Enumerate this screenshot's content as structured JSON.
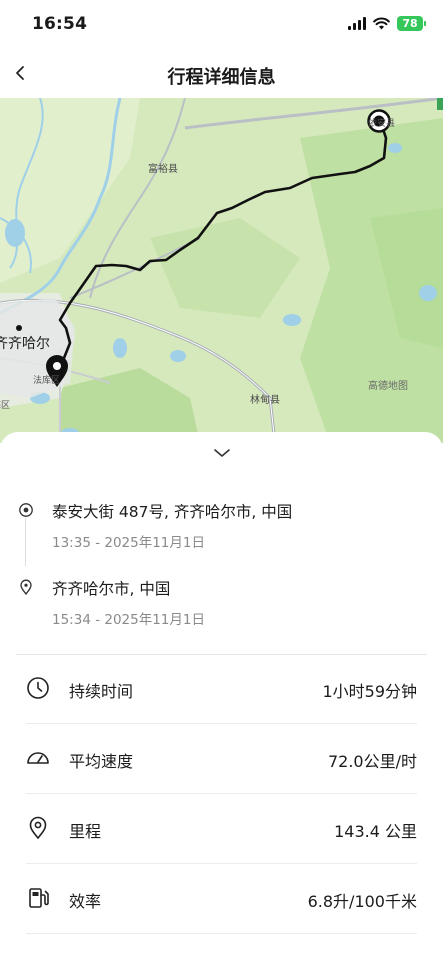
{
  "status_bar": {
    "time": "16:54",
    "battery": "78"
  },
  "nav": {
    "title": "行程详细信息"
  },
  "map": {
    "labels": {
      "fuyu": "富裕县",
      "qiqihar": "齐齐哈尔",
      "linxian": "林甸县",
      "gaode": "高德地图",
      "district_a": "法库区",
      "district_b": "梅区",
      "county_top": "依安县"
    }
  },
  "trip": {
    "start": {
      "address": "泰安大街 487号, 齐齐哈尔市, 中国",
      "time": "13:35 - 2025年11月1日"
    },
    "end": {
      "address": "齐齐哈尔市, 中国",
      "time": "15:34 - 2025年11月1日"
    }
  },
  "stats": [
    {
      "label": "持续时间",
      "value": "1小时59分钟",
      "icon": "clock-icon"
    },
    {
      "label": "平均速度",
      "value": "72.0公里/时",
      "icon": "speedometer-icon"
    },
    {
      "label": "里程",
      "value": "143.4 公里",
      "icon": "location-pin-icon"
    },
    {
      "label": "效率",
      "value": "6.8升/100千米",
      "icon": "fuel-pump-icon"
    }
  ],
  "colors": {
    "map_green": "#cfe5b5",
    "water": "#a9d5ea",
    "route": "#111111",
    "battery": "#35c759"
  }
}
